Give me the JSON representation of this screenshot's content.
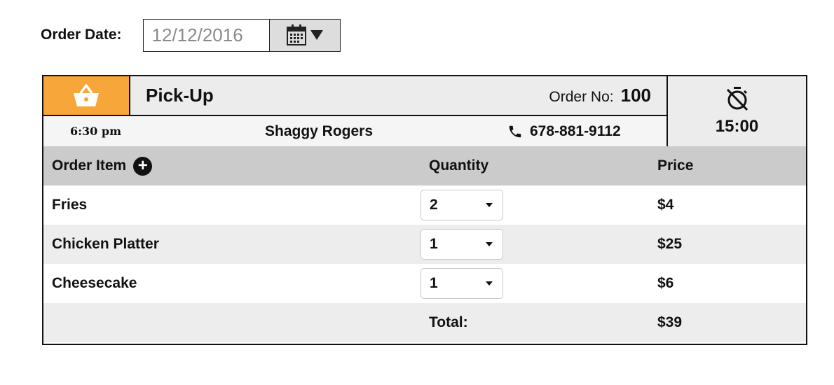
{
  "order_date": {
    "label": "Order Date:",
    "value": "12/12/2016",
    "calendar_icon": "calendar-icon",
    "dropdown_icon": "triangle-down-icon"
  },
  "order": {
    "type": "Pick-Up",
    "type_icon": "basket-icon",
    "type_color": "#f7a639",
    "number_label": "Order No:",
    "number": "100",
    "time": "6:30 pm",
    "customer": "Shaggy Rogers",
    "phone_icon": "phone-icon",
    "phone": "678-881-9112",
    "timer_icon": "timer-off-icon",
    "timer": "15:00"
  },
  "table": {
    "headers": {
      "item": "Order Item",
      "add_icon": "plus-circle-icon",
      "quantity": "Quantity",
      "price": "Price"
    },
    "rows": [
      {
        "item": "Fries",
        "quantity": "2",
        "price": "$4"
      },
      {
        "item": "Chicken Platter",
        "quantity": "1",
        "price": "$25"
      },
      {
        "item": "Cheesecake",
        "quantity": "1",
        "price": "$6"
      }
    ],
    "total_label": "Total:",
    "total": "$39"
  }
}
